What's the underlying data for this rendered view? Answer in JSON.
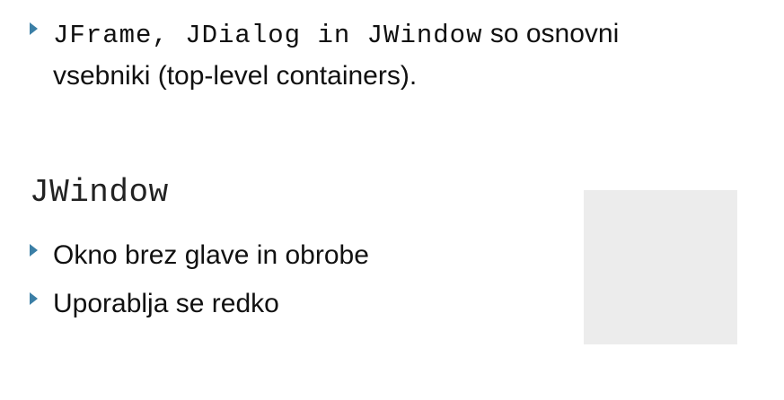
{
  "bullets_top": [
    {
      "code": "JFrame, JDialog in JWindow",
      "text": " so osnovni vsebniki (top-level containers)."
    }
  ],
  "heading": "JWindow",
  "bullets_bottom": [
    {
      "text": "Okno brez glave in obrobe"
    },
    {
      "text": "Uporablja se redko"
    }
  ],
  "colors": {
    "bullet_marker": "#3b7fa6",
    "image_placeholder": "#ececec"
  },
  "icons": {
    "bullet": "right-triangle-bullet-icon"
  }
}
